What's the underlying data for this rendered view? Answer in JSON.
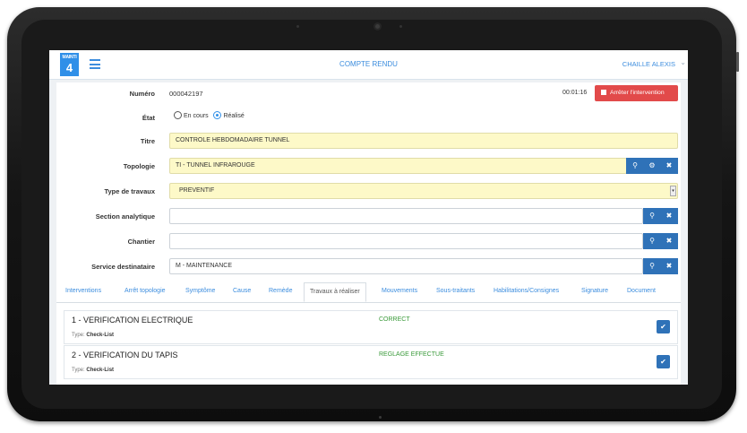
{
  "header": {
    "logo_top": "MAINTI",
    "logo_num": "4",
    "title": "COMPTE RENDU",
    "user": "CHAILLE ALEXIS"
  },
  "form": {
    "numero_label": "Numéro",
    "numero_value": "000042197",
    "timer": "00:01:16",
    "stop_label": "Arrêter l'intervention",
    "etat_label": "État",
    "etat_options": [
      "En cours",
      "Réalisé"
    ],
    "etat_selected": "Réalisé",
    "titre_label": "Titre",
    "titre_value": "CONTROLE HEBDOMADAIRE TUNNEL",
    "topologie_label": "Topologie",
    "topologie_value": "TI - TUNNEL INFRAROUGE",
    "type_travaux_label": "Type de travaux",
    "type_travaux_value": "PREVENTIF",
    "section_label": "Section analytique",
    "section_value": "",
    "chantier_label": "Chantier",
    "chantier_value": "",
    "service_label": "Service destinataire",
    "service_value": "M - MAINTENANCE"
  },
  "tabs": [
    "Interventions",
    "Arrêt topologie",
    "Symptôme",
    "Cause",
    "Remède",
    "Travaux à réaliser",
    "Mouvements",
    "Sous-traitants",
    "Habilitations/Consignes",
    "Signature",
    "Document"
  ],
  "active_tab": "Travaux à réaliser",
  "tasks": [
    {
      "title": "1 - VERIFICATION ELECTRIQUE",
      "type_label": "Type:",
      "type": "Check-List",
      "status": "CORRECT"
    },
    {
      "title": "2 - VERIFICATION DU TAPIS",
      "type_label": "Type:",
      "type": "Check-List",
      "status": "REGLAGE EFFECTUE"
    }
  ],
  "colors": {
    "accent": "#3c8dde",
    "button_blue": "#2f72b8",
    "stop_red": "#e24a4a",
    "field_yellow": "#fdf9c8",
    "status_green": "#3a9a3a"
  },
  "icons": {
    "search": "search-icon",
    "gear": "gear-icon",
    "close": "close-icon",
    "check": "check-icon",
    "menu": "hamburger-menu-icon"
  }
}
